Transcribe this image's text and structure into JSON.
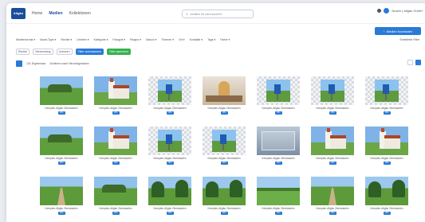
{
  "app": {
    "logo_text": "Allgäu"
  },
  "nav": {
    "home": "Home",
    "media": "Medien",
    "collections": "Kollektionen"
  },
  "search": {
    "placeholder": "Inhalten für nach suchen?"
  },
  "user": {
    "name": "Nutzer | Allgäu GmbH"
  },
  "upload_button": "Medien hochladen",
  "filters": [
    "Medienformat",
    "Asset-Type",
    "Rechte",
    "Urheber",
    "Kategorie",
    "Fotograf",
    "Region",
    "Saison",
    "Themen",
    "Ort",
    "Kontakte",
    "Tags",
    "Farbe"
  ],
  "filter_right": "Erweiterte Filter",
  "chips": [
    {
      "label": "Rechte",
      "style": "outline"
    },
    {
      "label": "Verwendung",
      "style": "outline"
    },
    {
      "label": "Lizenzen",
      "style": "outline"
    },
    {
      "label": "Filter zurücksetzen",
      "style": "blue"
    },
    {
      "label": "Filter speichern",
      "style": "green"
    }
  ],
  "count_text": "131 Ergebnisse",
  "sort_text": "Sortieren nach Hinzufügedatum",
  "caption_text": "Kempten-Allgäu Oberstaufen",
  "badge_text": "JPG",
  "rows": [
    [
      "meadow",
      "church",
      "sign",
      "interior",
      "sign",
      "sign",
      "sign"
    ],
    [
      "meadow",
      "church",
      "sign",
      "sign",
      "glass",
      "church",
      "church"
    ],
    [
      "path",
      "meadow",
      "trees",
      "trees",
      "field",
      "path",
      "trees"
    ]
  ]
}
